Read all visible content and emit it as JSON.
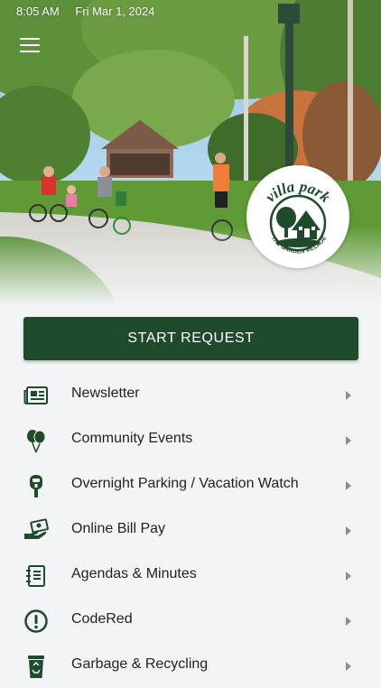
{
  "status_bar": {
    "time": "8:05 AM",
    "date": "Fri Mar 1, 2024"
  },
  "logo": {
    "text_top": "villa park",
    "text_bottom": "THE GARDEN VILLAGE"
  },
  "primary_action": {
    "label": "START REQUEST"
  },
  "menu": [
    {
      "label": "Newsletter",
      "icon": "newspaper-icon"
    },
    {
      "label": "Community Events",
      "icon": "balloons-icon"
    },
    {
      "label": "Overnight Parking / Vacation Watch",
      "icon": "parking-meter-icon"
    },
    {
      "label": "Online Bill Pay",
      "icon": "money-hand-icon"
    },
    {
      "label": "Agendas & Minutes",
      "icon": "notebook-icon"
    },
    {
      "label": "CodeRed",
      "icon": "alert-icon"
    },
    {
      "label": "Garbage & Recycling",
      "icon": "trash-can-icon"
    }
  ],
  "colors": {
    "brand_green": "#1f4a2c",
    "background": "#f3f4f6",
    "chevron": "#8d8d8d"
  }
}
